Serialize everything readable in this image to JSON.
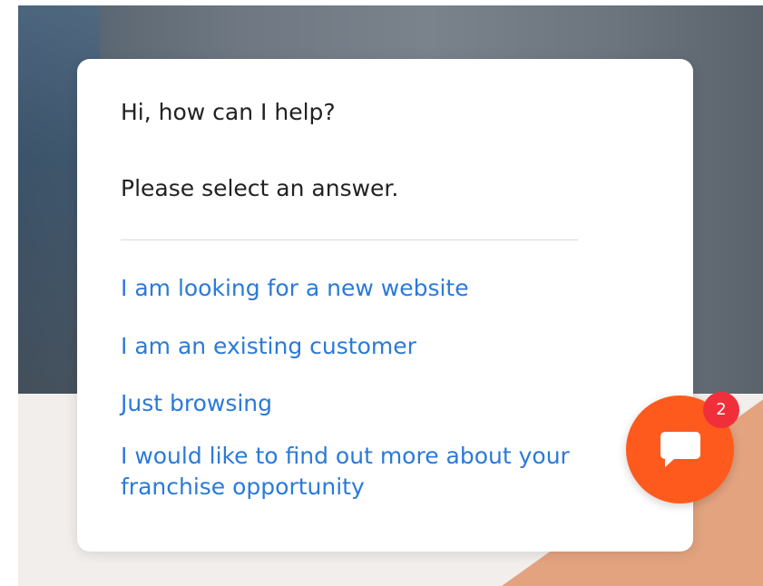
{
  "chat": {
    "greeting": "Hi, how can I help?",
    "prompt": "Please select an answer.",
    "options": [
      "I am looking for a new website",
      "I am an existing customer",
      "Just browsing",
      "I would like to find out more about your franchise opportunity"
    ]
  },
  "launcher": {
    "icon": "chat-bubble-icon",
    "badge_count": "2",
    "accent_color": "#fe5a1d",
    "badge_color": "#f12f3a"
  },
  "colors": {
    "link": "#2a7ad9",
    "text": "#222222"
  }
}
